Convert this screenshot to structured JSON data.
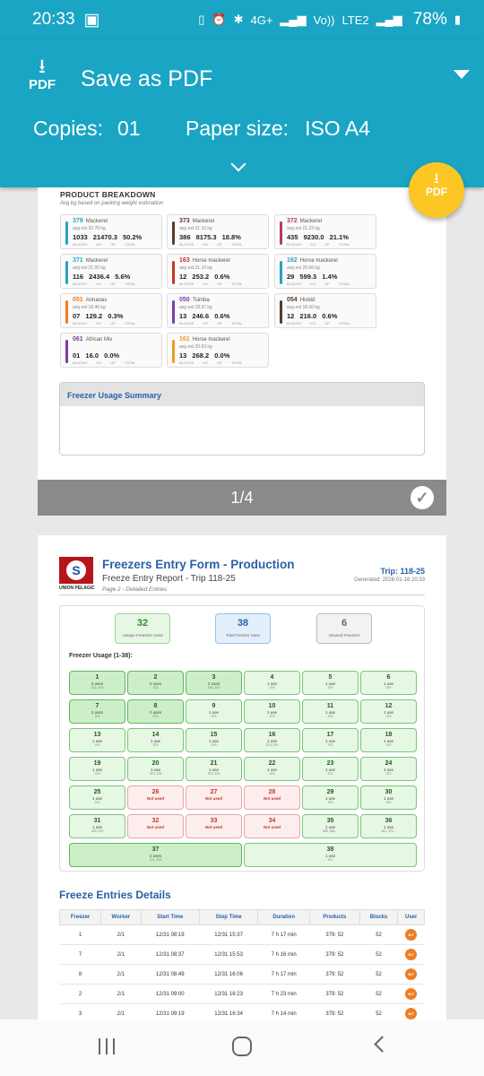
{
  "status": {
    "time": "20:33",
    "net_top": "4G+",
    "volte": "Vo))",
    "lte": "LTE2",
    "battery": "78%"
  },
  "header": {
    "printer": "Save as PDF",
    "copies_label": "Copies:",
    "copies_value": "01",
    "paper_label": "Paper size:",
    "paper_value": "ISO A4",
    "pdf_label": "PDF"
  },
  "fab": {
    "label": "PDF"
  },
  "page1": {
    "title": "PRODUCT BREAKDOWN",
    "subtitle": "Avg kg based on packing weight estimation",
    "units": "BLOCKS KG OF TOTAL",
    "products": [
      {
        "code": "379",
        "name": "Mackerel",
        "avg": "avg est 20.78 kg",
        "nums": "1033 21470.3 50.2%",
        "color": "#2aa3c2"
      },
      {
        "code": "373",
        "name": "Mackerel",
        "avg": "avg est 21.16 kg",
        "nums": "386 8175.3 18.8%",
        "color": "#5a3b2a"
      },
      {
        "code": "372",
        "name": "Mackerel",
        "avg": "avg est 21.22 kg",
        "nums": "435 9230.0 21.1%",
        "color": "#b03c6a"
      },
      {
        "code": "371",
        "name": "Mackerel",
        "avg": "avg est 21.00 kg",
        "nums": "116 2436.4 5.6%",
        "color": "#2aa3c2"
      },
      {
        "code": "163",
        "name": "Horse mackerel",
        "avg": "avg est 21.10 kg",
        "nums": "12 253.2 0.6%",
        "color": "#c0392b"
      },
      {
        "code": "162",
        "name": "Horse mackerel",
        "avg": "avg est 20.66 kg",
        "nums": "29 599.3 1.4%",
        "color": "#2aa3c2"
      },
      {
        "code": "051",
        "name": "Annanas",
        "avg": "avg est 18.46 kg",
        "nums": "07 129.2 0.3%",
        "color": "#ef7d22"
      },
      {
        "code": "050",
        "name": "Tsimba",
        "avg": "avg est 18.97 kg",
        "nums": "13 246.6 0.6%",
        "color": "#7b3fa1"
      },
      {
        "code": "054",
        "name": "Hisbid",
        "avg": "avg est 18.00 kg",
        "nums": "12 216.0 0.6%",
        "color": "#5a3b2a"
      },
      {
        "code": "061",
        "name": "African Mix",
        "avg": "",
        "nums": "01 16.0 0.0%",
        "color": "#7b3fa1"
      },
      {
        "code": "161",
        "name": "Horse mackerel",
        "avg": "avg est 20.63 kg",
        "nums": "13 268.2 0.0%",
        "color": "#ef9a22"
      }
    ],
    "usage_summary_title": "Freezer Usage Summary"
  },
  "pager": {
    "text": "1/4"
  },
  "page2": {
    "logo_text": "UNION PELAGIC",
    "title": "Freezers Entry Form - Production",
    "subtitle": "Freeze Entry Report - Trip 118-25",
    "subtitle2": "Page 2 - Detailed Entries",
    "trip": "Trip: 118-25",
    "generated": "Generated: 2026-01-16 20:33",
    "stats": [
      {
        "value": "32",
        "label": "Unique Freezers Used"
      },
      {
        "value": "38",
        "label": "Total Freezer Uses"
      },
      {
        "value": "6",
        "label": "Unused Freezers"
      }
    ],
    "usage_label": "Freezer Usage (1-38):",
    "cells": [
      {
        "n": "1",
        "u": "2 uses",
        "t": "372, 379",
        "s": "used"
      },
      {
        "n": "2",
        "u": "2 uses",
        "t": "372",
        "s": "used"
      },
      {
        "n": "3",
        "u": "2 uses",
        "t": "162, 372",
        "s": "used"
      },
      {
        "n": "4",
        "u": "1 use",
        "t": "379",
        "s": "used-1"
      },
      {
        "n": "5",
        "u": "1 use",
        "t": "379",
        "s": "used-1"
      },
      {
        "n": "6",
        "u": "1 use",
        "t": "379",
        "s": "used-1"
      },
      {
        "n": "7",
        "u": "2 uses",
        "t": "379",
        "s": "used"
      },
      {
        "n": "8",
        "u": "2 uses",
        "t": "373",
        "s": "used"
      },
      {
        "n": "9",
        "u": "1 use",
        "t": "379",
        "s": "used-1"
      },
      {
        "n": "10",
        "u": "1 use",
        "t": "379",
        "s": "used-1"
      },
      {
        "n": "11",
        "u": "1 use",
        "t": "372",
        "s": "used-1"
      },
      {
        "n": "12",
        "u": "1 use",
        "t": "372",
        "s": "used-1"
      },
      {
        "n": "13",
        "u": "1 use",
        "t": "379",
        "s": "used-1"
      },
      {
        "n": "14",
        "u": "1 use",
        "t": "379",
        "s": "used-1"
      },
      {
        "n": "15",
        "u": "1 use",
        "t": "379",
        "s": "used-1"
      },
      {
        "n": "16",
        "u": "1 use",
        "t": "373, 379",
        "s": "used-1"
      },
      {
        "n": "17",
        "u": "1 use",
        "t": "372",
        "s": "used-1"
      },
      {
        "n": "18",
        "u": "1 use",
        "t": "372",
        "s": "used-1"
      },
      {
        "n": "19",
        "u": "1 use",
        "t": "379",
        "s": "used-1"
      },
      {
        "n": "20",
        "u": "1 use",
        "t": "373, 379",
        "s": "used-1"
      },
      {
        "n": "21",
        "u": "1 use",
        "t": "372, 373",
        "s": "used-1"
      },
      {
        "n": "22",
        "u": "1 use",
        "t": "379",
        "s": "used-1"
      },
      {
        "n": "23",
        "u": "1 use",
        "t": "372",
        "s": "used-1"
      },
      {
        "n": "24",
        "u": "1 use",
        "t": "372",
        "s": "used-1"
      },
      {
        "n": "25",
        "u": "1 use",
        "t": "372",
        "s": "used-1"
      },
      {
        "n": "26",
        "u": "Not used",
        "t": "",
        "s": "unused"
      },
      {
        "n": "27",
        "u": "Not used",
        "t": "",
        "s": "unused"
      },
      {
        "n": "28",
        "u": "Not used",
        "t": "",
        "s": "unused"
      },
      {
        "n": "29",
        "u": "1 use",
        "t": "372",
        "s": "used-1"
      },
      {
        "n": "30",
        "u": "1 use",
        "t": "372",
        "s": "used-1"
      },
      {
        "n": "31",
        "u": "1 use",
        "t": "163, 372",
        "s": "used-1"
      },
      {
        "n": "32",
        "u": "Not used",
        "t": "",
        "s": "unused"
      },
      {
        "n": "33",
        "u": "Not used",
        "t": "",
        "s": "unused"
      },
      {
        "n": "34",
        "u": "Not used",
        "t": "",
        "s": "unused"
      },
      {
        "n": "35",
        "u": "1 use",
        "t": "050, 061...",
        "s": "used-1"
      },
      {
        "n": "36",
        "u": "1 use",
        "t": "161, 371...",
        "s": "used-1"
      },
      {
        "n": "37",
        "u": "2 uses",
        "t": "371, 379",
        "s": "used"
      },
      {
        "n": "38",
        "u": "1 use",
        "t": "371",
        "s": "used-1"
      }
    ],
    "entries_title": "Freeze Entries Details",
    "columns": [
      "Freezer",
      "Worker",
      "Start Time",
      "Stop Time",
      "Duration",
      "Products",
      "Blocks",
      "User"
    ],
    "rows": [
      [
        "1",
        "2/1",
        "12/31 08:19",
        "12/31 15:37",
        "7 h 17 min",
        "379: 52",
        "52",
        "B/T"
      ],
      [
        "7",
        "2/1",
        "12/31 08:37",
        "12/31 15:53",
        "7 h 16 min",
        "379: 52",
        "52",
        "B/T"
      ],
      [
        "8",
        "2/1",
        "12/31 08:49",
        "12/31 16:06",
        "7 h 17 min",
        "379: 52",
        "52",
        "B/T"
      ],
      [
        "2",
        "2/1",
        "12/31 09:00",
        "12/31 16:23",
        "7 h 23 min",
        "379: 52",
        "52",
        "B/T"
      ],
      [
        "3",
        "2/1",
        "12/31 09:19",
        "12/31 16:34",
        "7 h 14 min",
        "379: 52",
        "52",
        "B/T"
      ]
    ]
  }
}
